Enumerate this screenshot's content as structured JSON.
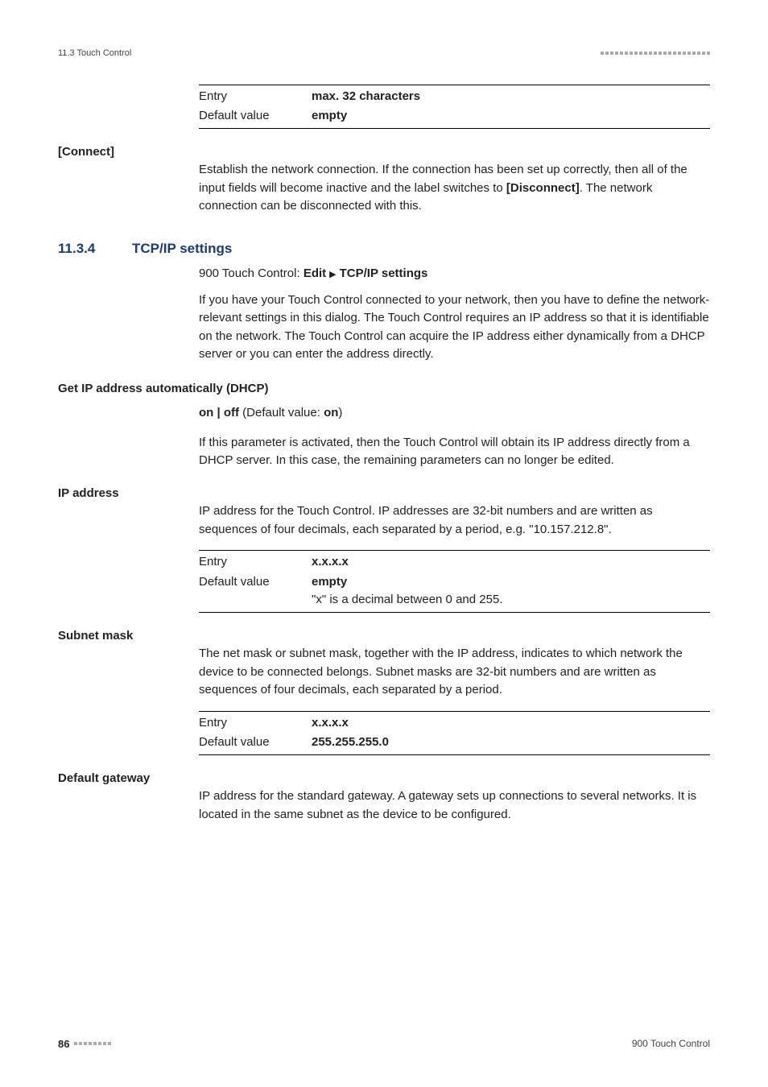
{
  "header": {
    "breadcrumb": "11.3 Touch Control"
  },
  "table1": {
    "row1_label": "Entry",
    "row1_value": "max. 32 characters",
    "row2_label": "Default value",
    "row2_value": "empty"
  },
  "connect": {
    "heading": "[Connect]",
    "body_a": "Establish the network connection. If the connection has been set up correctly, then all of the input fields will become inactive and the label switches to ",
    "body_bold": "[Disconnect]",
    "body_b": ". The network connection can be disconnected with this."
  },
  "section": {
    "num": "11.3.4",
    "title": "TCP/IP settings",
    "crumb_a": "900 Touch Control: ",
    "crumb_b": "Edit",
    "crumb_c": "TCP/IP settings",
    "intro": "If you have your Touch Control connected to your network, then you have to define the network-relevant settings in this dialog. The Touch Control requires an IP address so that it is identifiable on the network. The Touch Control can acquire the IP address either dynamically from a DHCP server or you can enter the address directly."
  },
  "dhcp": {
    "heading": "Get IP address automatically (DHCP)",
    "opts_a": "on | off",
    "opts_b": " (Default value: ",
    "opts_c": "on",
    "opts_d": ")",
    "body": "If this parameter is activated, then the Touch Control will obtain its IP address directly from a DHCP server. In this case, the remaining parameters can no longer be edited."
  },
  "ip": {
    "heading": "IP address",
    "body": "IP address for the Touch Control. IP addresses are 32-bit numbers and are written as sequences of four decimals, each separated by a period, e.g. \"10.157.212.8\".",
    "row1_label": "Entry",
    "row1_value": "x.x.x.x",
    "row2_label": "Default value",
    "row2_value": "empty",
    "row2_note": "\"x\" is a decimal between 0 and 255."
  },
  "subnet": {
    "heading": "Subnet mask",
    "body": "The net mask or subnet mask, together with the IP address, indicates to which network the device to be connected belongs. Subnet masks are 32-bit numbers and are written as sequences of four decimals, each separated by a period.",
    "row1_label": "Entry",
    "row1_value": "x.x.x.x",
    "row2_label": "Default value",
    "row2_value": "255.255.255.0"
  },
  "gateway": {
    "heading": "Default gateway",
    "body": "IP address for the standard gateway. A gateway sets up connections to several networks. It is located in the same subnet as the device to be configured."
  },
  "footer": {
    "page": "86",
    "product": "900 Touch Control"
  }
}
